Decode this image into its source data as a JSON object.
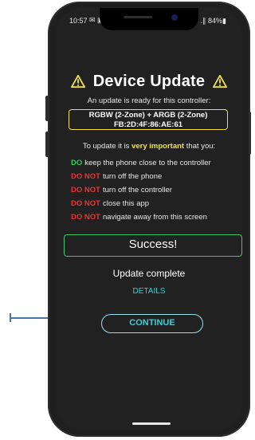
{
  "status_bar": {
    "time": "10:57",
    "left_icons": "✉ ▣",
    "right": "↗ .∥ 84%▮"
  },
  "colors": {
    "background": "#212121",
    "warning": "#f3e14a",
    "success": "#3fc769",
    "do_green": "#2ecf5b",
    "do_not_red": "#ea3434",
    "link_cyan": "#35d1dc"
  },
  "header": {
    "title": "Device Update",
    "icon": "warning-triangle-icon"
  },
  "subtitle": "An update is ready for this controller:",
  "device": {
    "name": "RGBW (2-Zone) + ARGB (2-Zone)",
    "mac": "FB:2D:4F:86:AE:61"
  },
  "instructions": {
    "prefix": "To update it is",
    "highlight": "very important",
    "suffix": "that you:"
  },
  "rules": [
    {
      "keyword": "DO",
      "type": "do",
      "text": "keep the phone close to the controller"
    },
    {
      "keyword": "DO NOT",
      "type": "dont",
      "text": "turn off the phone"
    },
    {
      "keyword": "DO NOT",
      "type": "dont",
      "text": "turn off the controller"
    },
    {
      "keyword": "DO NOT",
      "type": "dont",
      "text": "close this app"
    },
    {
      "keyword": "DO NOT",
      "type": "dont",
      "text": "navigate away from this screen"
    }
  ],
  "result": {
    "status": "Success!",
    "message": "Update complete",
    "details_link": "DETAILS"
  },
  "actions": {
    "continue_label": "CONTINUE"
  }
}
